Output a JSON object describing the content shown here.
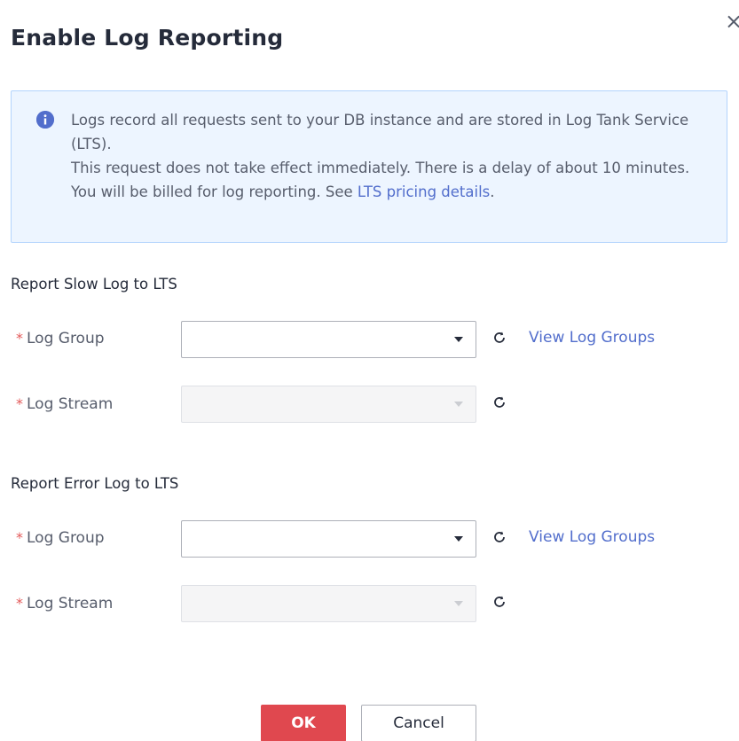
{
  "dialog": {
    "title": "Enable Log Reporting",
    "close_label": "×"
  },
  "notice": {
    "icon": "info-icon",
    "line1": "Logs record all requests sent to your DB instance and are stored in Log Tank Service (LTS).",
    "line2": "This request does not take effect immediately. There is a delay of about 10 minutes.",
    "line3_prefix": "You will be billed for log reporting. See ",
    "line3_link": "LTS pricing details",
    "line3_suffix": "."
  },
  "slow_log": {
    "section_title": "Report Slow Log to LTS",
    "log_group_label": "Log Group",
    "log_group_value": "",
    "log_stream_label": "Log Stream",
    "log_stream_value": "",
    "view_link": "View Log Groups"
  },
  "error_log": {
    "section_title": "Report Error Log to LTS",
    "log_group_label": "Log Group",
    "log_group_value": "",
    "log_stream_label": "Log Stream",
    "log_stream_value": "",
    "view_link": "View Log Groups"
  },
  "required_mark": "*",
  "buttons": {
    "ok": "OK",
    "cancel": "Cancel"
  },
  "colors": {
    "primary": "#e0484f",
    "link": "#526ecc",
    "notice_bg": "#edf5ff",
    "required": "#e35a5a"
  }
}
